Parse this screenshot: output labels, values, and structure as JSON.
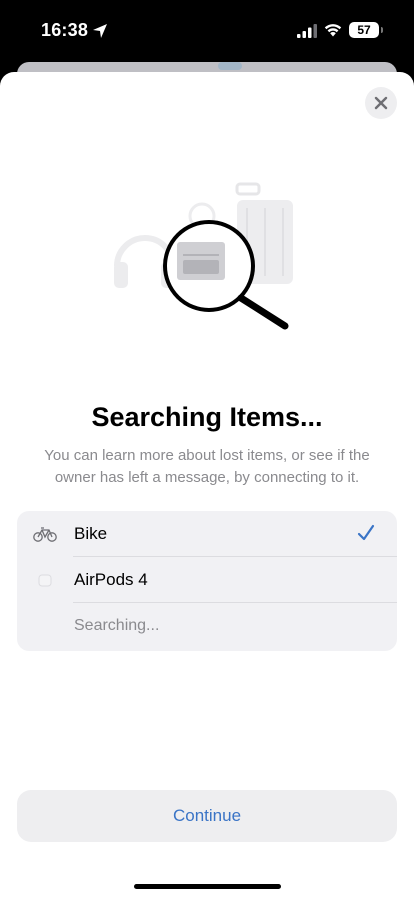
{
  "status_bar": {
    "time": "16:38",
    "battery": "57"
  },
  "icons": {
    "location": "location-arrow-icon",
    "signal": "cellular-signal-icon",
    "wifi": "wifi-icon",
    "close": "close-icon",
    "illustration": "magnifying-glass-icon",
    "bike": "bicycle-icon",
    "airpods": "airpods-case-icon",
    "check": "checkmark-icon"
  },
  "sheet": {
    "title": "Searching Items...",
    "subtitle": "You can learn more about lost items, or see if the owner has left a message, by connecting to it."
  },
  "items": [
    {
      "label": "Bike",
      "selected": true
    },
    {
      "label": "AirPods 4",
      "selected": false
    },
    {
      "label": "Searching...",
      "selected": false
    }
  ],
  "actions": {
    "continue_label": "Continue"
  },
  "colors": {
    "accent": "#3a74c6",
    "secondary_text": "#8a8a8e",
    "list_background": "#f1f1f4"
  }
}
